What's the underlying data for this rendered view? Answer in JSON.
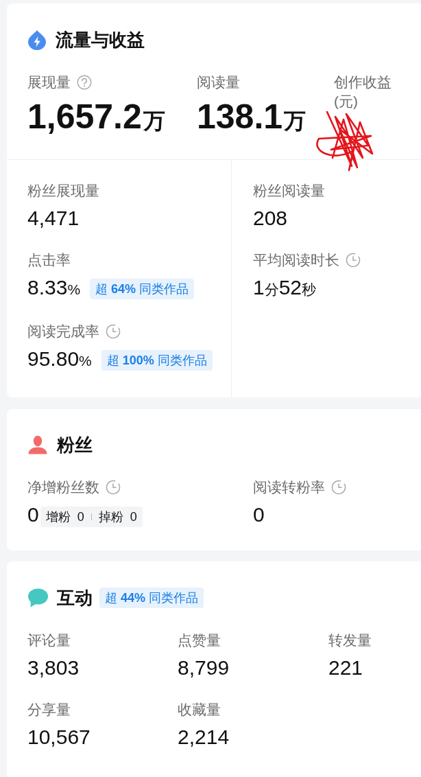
{
  "traffic": {
    "title": "流量与收益",
    "metrics": [
      {
        "label": "展现量",
        "kind": "help",
        "value": [
          {
            "text": "1,657.2",
            "kind": "number"
          },
          {
            "text": "万",
            "kind": "unit"
          }
        ]
      },
      {
        "label": "阅读量",
        "value": [
          {
            "text": "138.1",
            "kind": "number"
          },
          {
            "text": "万",
            "kind": "unit"
          }
        ]
      },
      {
        "label": "创作收益(元)",
        "kind": "redacted"
      }
    ],
    "details": [
      {
        "metrics": [
          {
            "label": "粉丝展现量",
            "value": [
              {
                "text": "4,471",
                "kind": "number"
              }
            ]
          },
          {
            "label": "点击率",
            "value": [
              {
                "text": "8.33",
                "kind": "number"
              },
              {
                "text": "%",
                "kind": "unit"
              }
            ],
            "badge": "超 **64%** 同类作品"
          },
          {
            "label": "阅读完成率",
            "kind": "clock",
            "value": [
              {
                "text": "95.80",
                "kind": "number"
              },
              {
                "text": "%",
                "kind": "unit"
              }
            ],
            "badge": "超 **100%** 同类作品"
          }
        ]
      },
      {
        "metrics": [
          {
            "label": "粉丝阅读量",
            "value": [
              {
                "text": "208",
                "kind": "number"
              }
            ]
          },
          {
            "label": "平均阅读时长",
            "kind": "clock",
            "value": [
              {
                "text": "1",
                "kind": "number"
              },
              {
                "text": "分",
                "kind": "unit"
              },
              {
                "text": "52",
                "kind": "number"
              },
              {
                "text": "秒",
                "kind": "unit"
              }
            ]
          }
        ]
      }
    ]
  },
  "fans": {
    "title": "粉丝",
    "metrics": [
      {
        "label": "净增粉丝数",
        "kind": "clock",
        "value": [
          {
            "text": "0",
            "kind": "number"
          }
        ],
        "breakdown": [
          {
            "label": "增粉",
            "value": "0"
          },
          {
            "label": "掉粉",
            "value": "0"
          }
        ]
      },
      {
        "label": "阅读转粉率",
        "kind": "clock",
        "value": [
          {
            "text": "0",
            "kind": "number"
          }
        ]
      }
    ]
  },
  "interaction": {
    "title": "互动",
    "badge": "超 **44%** 同类作品",
    "metrics": [
      {
        "label": "评论量",
        "value": [
          {
            "text": "3,803",
            "kind": "number"
          }
        ]
      },
      {
        "label": "点赞量",
        "value": [
          {
            "text": "8,799",
            "kind": "number"
          }
        ]
      },
      {
        "label": "转发量",
        "value": [
          {
            "text": "221",
            "kind": "number"
          }
        ]
      },
      {
        "label": "分享量",
        "value": [
          {
            "text": "10,567",
            "kind": "number"
          }
        ]
      },
      {
        "label": "收藏量",
        "value": [
          {
            "text": "2,214",
            "kind": "number"
          }
        ]
      }
    ]
  }
}
